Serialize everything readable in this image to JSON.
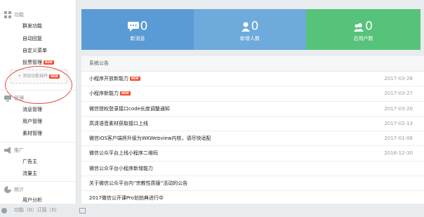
{
  "sidebar": {
    "sections": [
      {
        "label": "功能",
        "icon": "grid-icon",
        "items": [
          "群发功能",
          "自动回复",
          "自定义菜单",
          "投票管理"
        ],
        "badge_on": "投票管理",
        "badge": "NEW"
      },
      {
        "label": "管理",
        "icon": "monitor-icon",
        "items": [
          "消息管理",
          "用户管理",
          "素材管理"
        ]
      },
      {
        "label": "推广",
        "icon": "megaphone-icon",
        "items": [
          "广告主",
          "流量主"
        ]
      },
      {
        "label": "统计",
        "icon": "pie-chart-icon",
        "items": [
          "用户分析"
        ]
      }
    ],
    "add_plugin_label": "+ 添加功能插件",
    "add_plugin_badge": "NEW"
  },
  "stats": {
    "messages": {
      "value": "0",
      "label": "新消息",
      "icon": "chat-icon",
      "color": "#5b9bd5"
    },
    "new_fans": {
      "value": "0",
      "label": "新增人数",
      "icon": "person-icon",
      "color": "#6eaadb"
    },
    "total_users": {
      "value": "0",
      "label": "总用户数",
      "icon": "users-icon",
      "color": "#56c27a"
    }
  },
  "notices": {
    "title": "系统公告",
    "badge": "NEW",
    "rows": [
      {
        "text": "小程序开放新能力",
        "date": "2017-03-28",
        "new": true
      },
      {
        "text": "小程序新能力",
        "date": "2017-03-27",
        "new": true
      },
      {
        "text": "微信授权登录接口code长度调整通知",
        "date": "2017-03-20",
        "new": false
      },
      {
        "text": "高清语音素材获取接口上线",
        "date": "2017-02-13",
        "new": false
      },
      {
        "text": "微信iOS客户端将升级为WKWebview内核，请尽快适配",
        "date": "2017-01-06",
        "new": false
      },
      {
        "text": "微信公众平台上线小程序二维码",
        "date": "2016-12-30",
        "new": false
      },
      {
        "text": "微信公众平台小程序新增能力",
        "date": "",
        "new": false
      },
      {
        "text": "关于微信公众平台内“宗教性质服”活动的公告",
        "date": "",
        "new": false
      },
      {
        "text": "2017微信公开课Pro划拍典进行中",
        "date": "",
        "new": false
      }
    ]
  },
  "footer": {
    "text": "功能（0）订阅（0）",
    "icon": "avatar-icon"
  },
  "colors": {
    "accent_red": "#e04b3a",
    "badge": "#f44d2c"
  }
}
